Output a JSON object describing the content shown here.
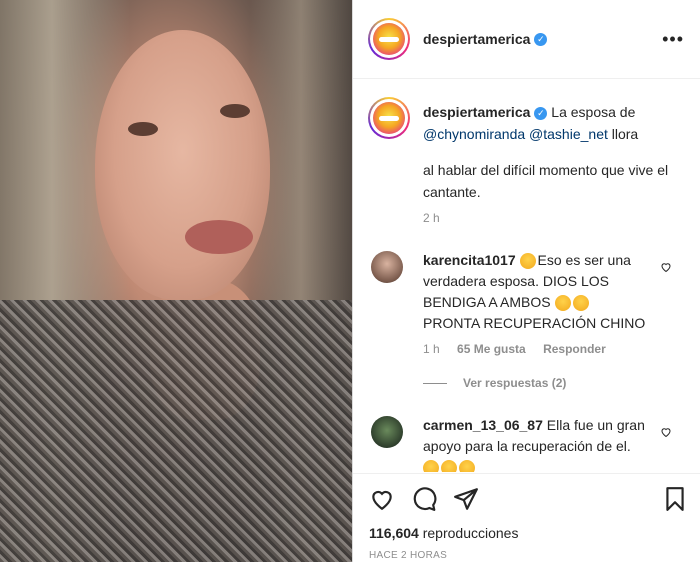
{
  "post": {
    "username": "despiertamerica",
    "caption_line1_rest": "La esposa de",
    "mention1": "@chynomiranda",
    "mention2": "@tashie_net",
    "caption_line2_rest": "llora",
    "caption_body": "al hablar del difícil momento que vive el cantante.",
    "time": "2 h"
  },
  "comments": [
    {
      "username": "karencita1017",
      "text": "Eso es ser una verdadera esposa. DIOS LOS BENDIGA A AMBOS",
      "text2": "PRONTA RECUPERACIÓN CHINO",
      "time": "1 h",
      "likes": "65 Me gusta",
      "reply": "Responder",
      "view_replies": "Ver respuestas (2)"
    },
    {
      "username": "carmen_13_06_87",
      "text": "Ella fue un gran apoyo para la recuperación de el."
    }
  ],
  "footer": {
    "views_count": "116,604",
    "views_label": "reproducciones",
    "ago": "HACE 2 HORAS"
  },
  "icons": {
    "verified": "verified-badge-icon",
    "more": "more-options-icon",
    "heart": "heart-icon",
    "comment": "comment-icon",
    "share": "share-icon",
    "save": "bookmark-icon"
  },
  "colors": {
    "mention": "#00376b",
    "verified": "#3897f0",
    "muted": "#8e8e8e"
  }
}
